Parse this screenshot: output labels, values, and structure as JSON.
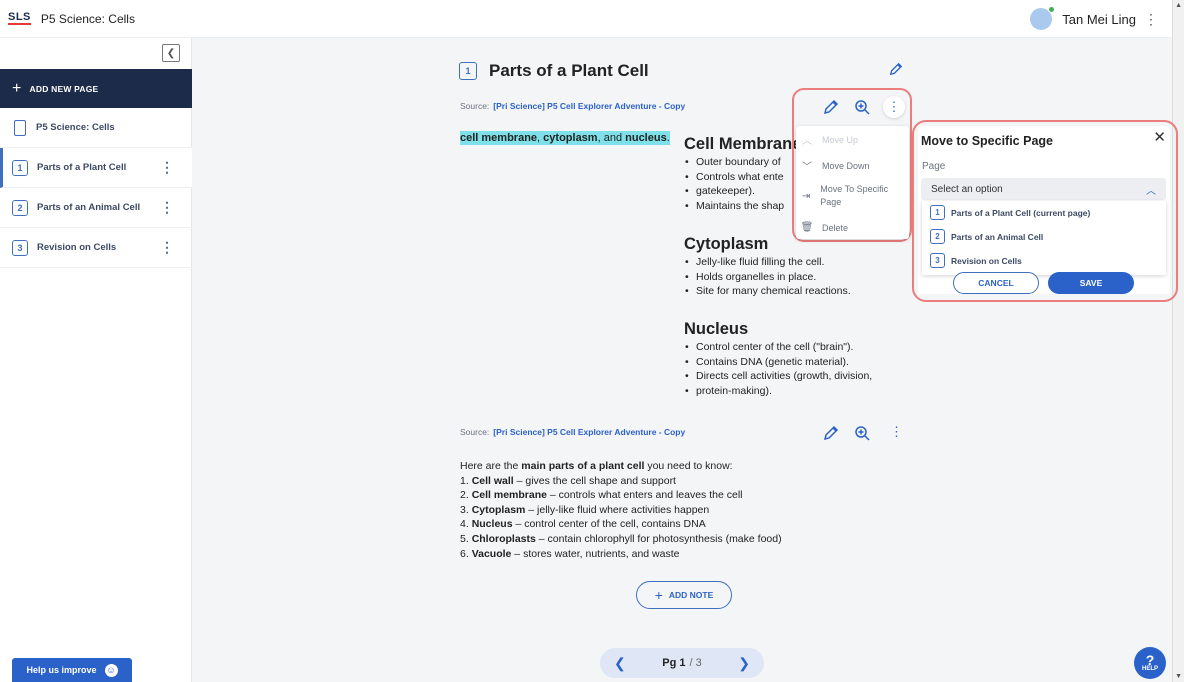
{
  "header": {
    "logo": "SLS",
    "title": "P5 Science: Cells",
    "user_name": "Tan Mei Ling",
    "more_icon": "⋮"
  },
  "sidebar": {
    "add_page_label": "ADD NEW PAGE",
    "lesson_label": "P5 Science: Cells",
    "items": [
      {
        "num": "1",
        "label": "Parts of a Plant Cell"
      },
      {
        "num": "2",
        "label": "Parts of an Animal Cell"
      },
      {
        "num": "3",
        "label": "Revision on Cells"
      }
    ],
    "improve_label": "Help us improve"
  },
  "page": {
    "num": "1",
    "title": "Parts of a Plant Cell",
    "source_label": "Source:",
    "source_link": "[Pri Science] P5 Cell Explorer Adventure - Copy",
    "highlight": {
      "w1": "cell membrane",
      "sep1": ", ",
      "w2": "cytoplasm",
      "sep2": ", and ",
      "w3": "nucleus",
      "end": "."
    },
    "sections": [
      {
        "title": "Cell Membrane",
        "bullets": [
          "Outer boundary of",
          "Controls what ente",
          "gatekeeper).",
          "Maintains the shap"
        ]
      },
      {
        "title": "Cytoplasm",
        "bullets": [
          "Jelly-like fluid filling the cell.",
          "Holds organelles in place.",
          "Site for many chemical reactions."
        ]
      },
      {
        "title": "Nucleus",
        "bullets": [
          "Control center of the cell (\"brain\").",
          "Contains DNA (genetic material).",
          "Directs cell activities (growth, division,",
          "protein-making)."
        ]
      }
    ],
    "parts_intro": {
      "pre": "Here are the ",
      "bold": "main parts of a plant cell",
      "post": " you need to know:"
    },
    "parts": [
      {
        "n": "1. ",
        "name": "Cell wall",
        "desc": " – gives the cell shape and support"
      },
      {
        "n": "2. ",
        "name": "Cell membrane",
        "desc": " – controls what enters and leaves the cell"
      },
      {
        "n": "3. ",
        "name": "Cytoplasm",
        "desc": " – jelly-like fluid where activities happen"
      },
      {
        "n": "4. ",
        "name": "Nucleus",
        "desc": " – control center of the cell, contains DNA"
      },
      {
        "n": "5. ",
        "name": "Chloroplasts",
        "desc": " – contain chlorophyll for photosynthesis (make food)"
      },
      {
        "n": "6. ",
        "name": "Vacuole",
        "desc": " – stores water, nutrients, and waste"
      }
    ],
    "add_note_label": "ADD NOTE"
  },
  "context_menu": {
    "move_up": "Move Up",
    "move_down": "Move Down",
    "move_to": "Move To Specific Page",
    "delete": "Delete"
  },
  "modal": {
    "title": "Move to Specific Page",
    "field_label": "Page",
    "placeholder": "Select an option",
    "options": [
      {
        "num": "1",
        "label": "Parts of a Plant Cell (current page)"
      },
      {
        "num": "2",
        "label": "Parts of an Animal Cell"
      },
      {
        "num": "3",
        "label": "Revision on Cells"
      }
    ],
    "cancel": "CANCEL",
    "save": "SAVE"
  },
  "pager": {
    "label": "Pg 1",
    "total": "/ 3"
  },
  "help_label": "HELP"
}
